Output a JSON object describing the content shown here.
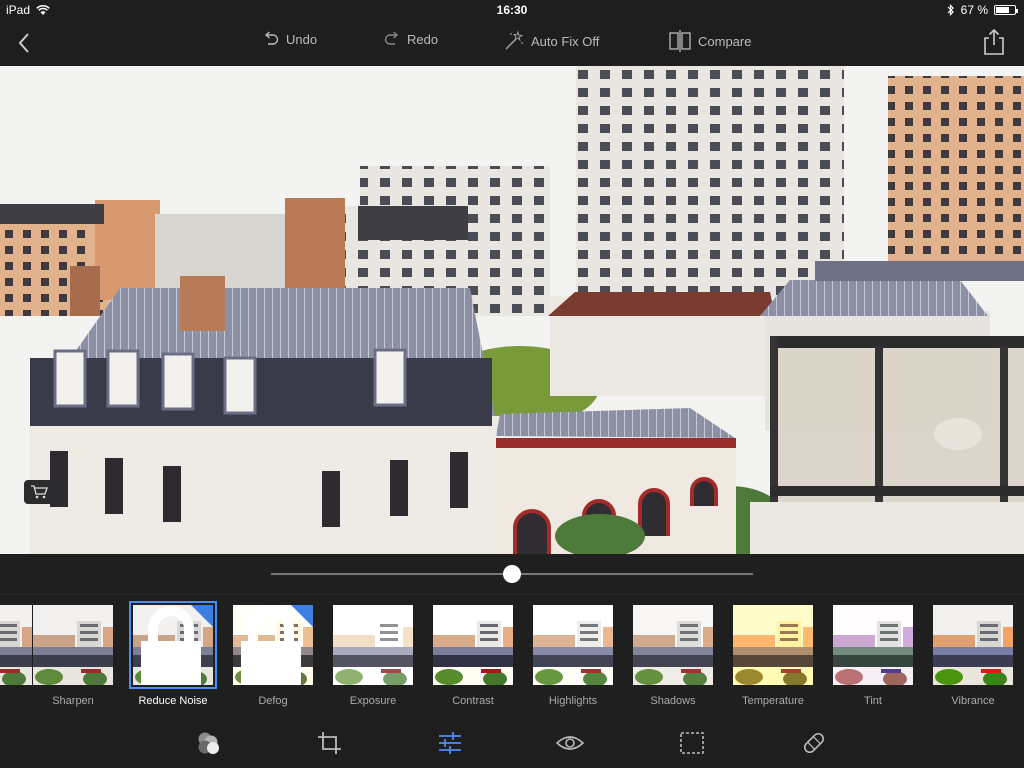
{
  "status": {
    "device": "iPad",
    "time": "16:30",
    "battery": "67 %",
    "battery_level": 0.67
  },
  "toolbar": {
    "undo_label": "Undo",
    "redo_label": "Redo",
    "autofix_label": "Auto Fix Off",
    "compare_label": "Compare"
  },
  "icons": {
    "back": "chevron-left-icon",
    "share": "share-icon",
    "undo": "undo-icon",
    "redo": "redo-icon",
    "autofix": "magic-wand-icon",
    "compare": "compare-icon",
    "cart": "cart-icon",
    "lock": "lock-icon"
  },
  "slider": {
    "value": 0.5
  },
  "filters": [
    {
      "label": "Sharpen",
      "locked": false,
      "selected": false
    },
    {
      "label": "Reduce Noise",
      "locked": true,
      "selected": true
    },
    {
      "label": "Defog",
      "locked": true,
      "selected": false
    },
    {
      "label": "Exposure",
      "locked": false,
      "selected": false
    },
    {
      "label": "Contrast",
      "locked": false,
      "selected": false
    },
    {
      "label": "Highlights",
      "locked": false,
      "selected": false
    },
    {
      "label": "Shadows",
      "locked": false,
      "selected": false
    },
    {
      "label": "Temperature",
      "locked": false,
      "selected": false
    },
    {
      "label": "Tint",
      "locked": false,
      "selected": false
    },
    {
      "label": "Vibrance",
      "locked": false,
      "selected": false
    }
  ],
  "tools": [
    "looks-icon",
    "crop-icon",
    "adjustments-icon",
    "red-eye-icon",
    "border-icon",
    "healing-icon"
  ],
  "colors": {
    "accent": "#4a8ef0",
    "background": "#1f1f1f",
    "lock_badge": "#3d7fe3"
  }
}
